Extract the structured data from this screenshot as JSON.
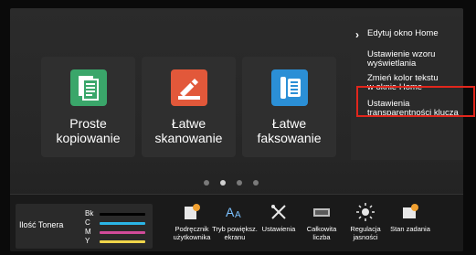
{
  "home": {
    "tiles": [
      {
        "label": "Proste\nkopiowanie",
        "icon": "copy-icon",
        "color": "#3aa66a"
      },
      {
        "label": "Łatwe\nskanowanie",
        "icon": "scan-icon",
        "color": "#e2583a"
      },
      {
        "label": "Łatwe\nfaksowanie",
        "icon": "fax-icon",
        "color": "#2b8fd6"
      },
      {
        "label": "",
        "icon": "",
        "color": "#2f2f2f"
      }
    ],
    "pagination": {
      "pages": 4,
      "active": 1
    }
  },
  "menu": {
    "items": [
      {
        "label": "Edytuj okno Home"
      },
      {
        "label": "Ustawienie wzoru\nwyświetlania"
      },
      {
        "label": "Zmień kolor tekstu\nw oknie Home"
      },
      {
        "label": "Ustawienia\ntransparentności klucza"
      }
    ],
    "selected_index": 3,
    "selected_color": "#e1261c"
  },
  "bottom_bar": {
    "toner": {
      "label": "Ilość Tonera",
      "channels": [
        {
          "key": "Bk",
          "color": "#000000"
        },
        {
          "key": "C",
          "color": "#2bb5e6"
        },
        {
          "key": "M",
          "color": "#d14b9a"
        },
        {
          "key": "Y",
          "color": "#f0d54a"
        }
      ]
    },
    "items": [
      {
        "label": "Podręcznik\nużytkownika",
        "icon": "manual-icon"
      },
      {
        "label": "Tryb powiększ.\nekranu",
        "icon": "zoom-text-icon"
      },
      {
        "label": "Ustawienia",
        "icon": "settings-icon"
      },
      {
        "label": "Całkowita\nliczba",
        "icon": "counter-icon"
      },
      {
        "label": "Regulacja\njasności",
        "icon": "brightness-icon"
      },
      {
        "label": "Stan zadania",
        "icon": "job-status-icon"
      }
    ]
  }
}
